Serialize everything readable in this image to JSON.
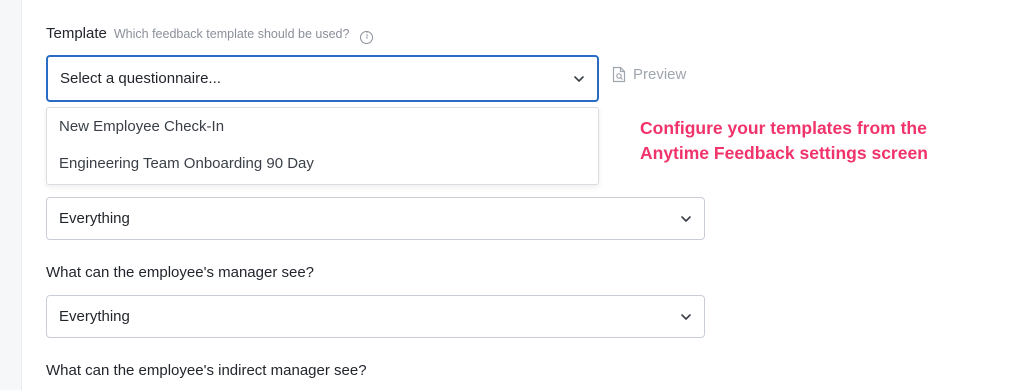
{
  "template": {
    "label": "Template",
    "hint": "Which feedback template should be used?",
    "info_icon": "i",
    "select_value": "Select a questionnaire...",
    "preview_label": "Preview",
    "options": [
      "New Employee Check-In",
      "Engineering Team Onboarding 90 Day"
    ]
  },
  "annotation": {
    "line1": "Configure your templates from the",
    "line2": "Anytime Feedback settings screen",
    "color": "#f0336b"
  },
  "visibility": {
    "first_select_value": "Everything",
    "manager_question": "What can the employee's manager see?",
    "manager_select_value": "Everything",
    "indirect_manager_question": "What can the employee's indirect manager see?"
  },
  "colors": {
    "focus": "#2a6cc4",
    "border": "#c9ced6"
  }
}
